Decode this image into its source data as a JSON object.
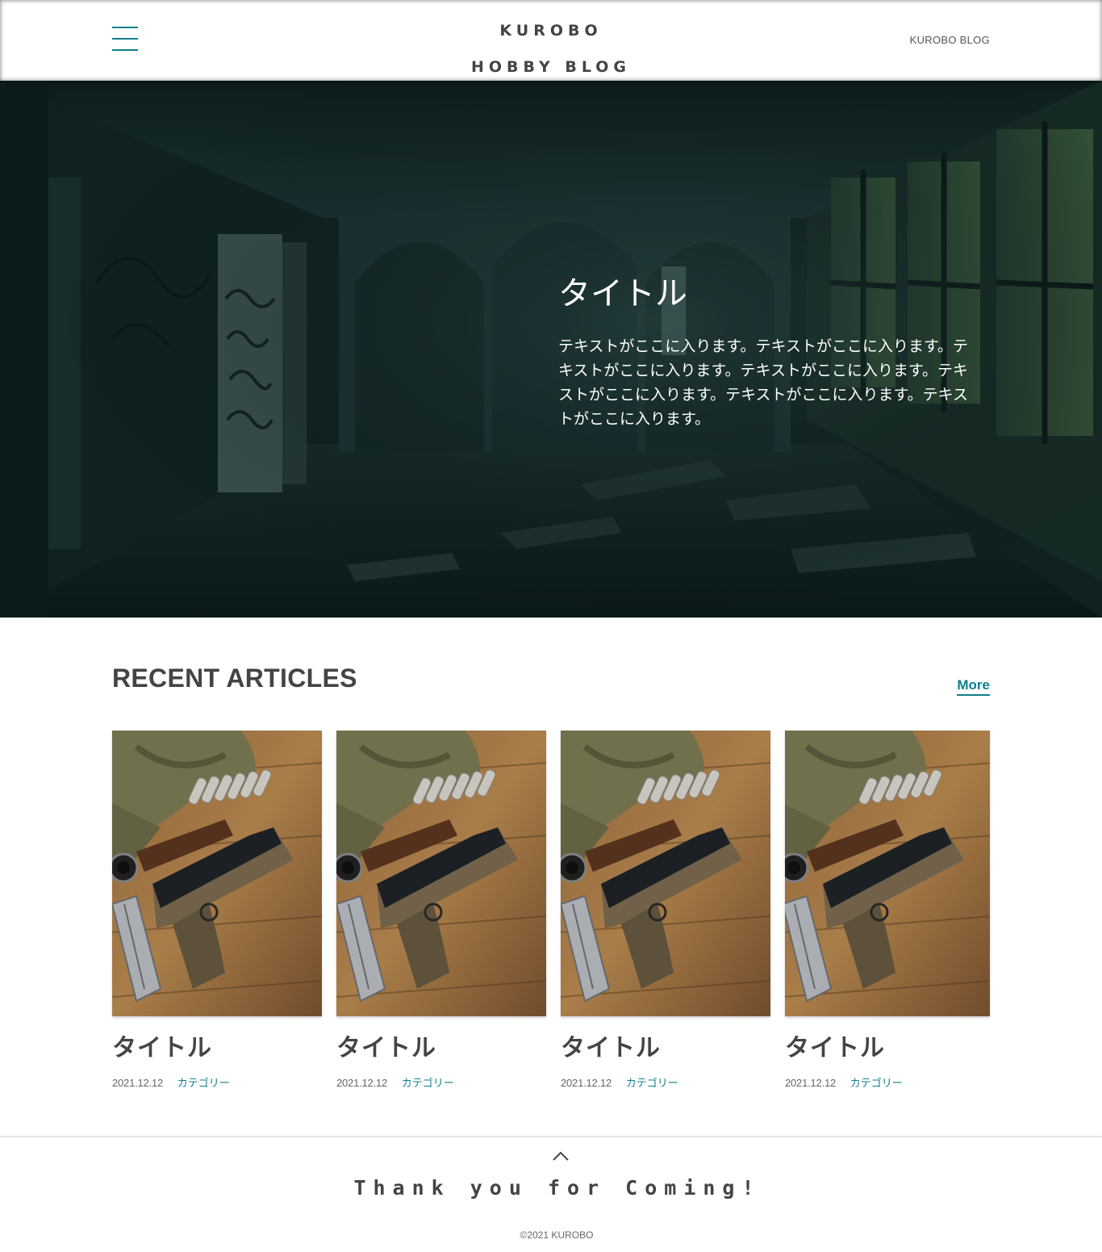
{
  "header": {
    "logo_line1": "KUROBO",
    "logo_line2": "HOBBY BLOG",
    "nav_link": "KUROBO BLOG",
    "menu_icon": "hamburger-menu-icon"
  },
  "hero": {
    "title": "タイトル",
    "body": "テキストがここに入ります。テキストがここに入ります。テキストがここに入ります。テキストがここに入ります。テキストがここに入ります。テキストがここに入ります。テキストがここに入ります。",
    "image": "abandoned-building-interior-photo"
  },
  "recent": {
    "heading": "RECENT ARTICLES",
    "more_label": "More",
    "articles": [
      {
        "title": "タイトル",
        "date": "2021.12.12",
        "category": "カテゴリー",
        "image": "pistol-gear-on-wood-photo"
      },
      {
        "title": "タイトル",
        "date": "2021.12.12",
        "category": "カテゴリー",
        "image": "pistol-gear-on-wood-photo"
      },
      {
        "title": "タイトル",
        "date": "2021.12.12",
        "category": "カテゴリー",
        "image": "pistol-gear-on-wood-photo"
      },
      {
        "title": "タイトル",
        "date": "2021.12.12",
        "category": "カテゴリー",
        "image": "pistol-gear-on-wood-photo"
      }
    ]
  },
  "footer": {
    "message": "Thank you for Coming!",
    "copyright": "©2021 KUROBO",
    "to_top_icon": "chevron-up-icon"
  },
  "colors": {
    "accent": "#0f7f8c",
    "text": "#444444",
    "hero_tint": "#0d1c1b"
  }
}
